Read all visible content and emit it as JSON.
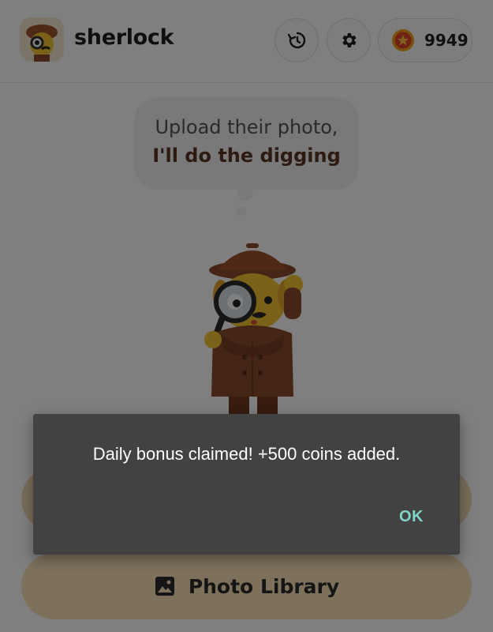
{
  "header": {
    "brand": "sherlock",
    "coins": "9949",
    "icons": {
      "history": "history-icon",
      "settings": "gear-icon",
      "coin": "star-coin-icon"
    }
  },
  "bubble": {
    "line1": "Upload their photo,",
    "line2": "I'll do the digging"
  },
  "buttons": {
    "photo_library_label": "Photo Library"
  },
  "dialog": {
    "message": "Daily bonus claimed! +500 coins added.",
    "ok_label": "OK"
  },
  "colors": {
    "accent": "#fbe3b9",
    "dialog_bg": "#424242",
    "ok_text": "#7fd3c7",
    "bubble_bold_text": "#5a3424"
  }
}
